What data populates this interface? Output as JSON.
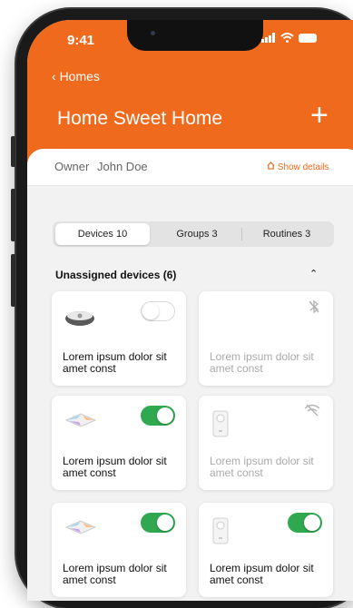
{
  "status_bar": {
    "time": "9:41"
  },
  "nav": {
    "back_label": "Homes",
    "title": "Home Sweet Home",
    "add_label": "+"
  },
  "owner": {
    "label": "Owner",
    "name": "John Doe",
    "show_details": "Show details"
  },
  "tabs": [
    {
      "label": "Devices 10",
      "active": true
    },
    {
      "label": "Groups 3",
      "active": false
    },
    {
      "label": "Routines 3",
      "active": false
    }
  ],
  "section": {
    "title": "Unassigned devices (6)"
  },
  "devices": [
    {
      "label": "Lorem ipsum dolor sit amet const",
      "icon": "light-dome-icon",
      "status": "toggle-off",
      "muted": false
    },
    {
      "label": "Lorem ipsum dolor sit amet const",
      "icon": "none",
      "status": "bluetooth-off",
      "muted": true
    },
    {
      "label": "Lorem ipsum dolor sit amet const",
      "icon": "light-panel-icon",
      "status": "toggle-on",
      "muted": false
    },
    {
      "label": "Lorem ipsum dolor sit amet const",
      "icon": "smart-plug-icon",
      "status": "wifi-off",
      "muted": true
    },
    {
      "label": "Lorem ipsum dolor sit amet const",
      "icon": "light-panel-icon",
      "status": "toggle-on",
      "muted": false
    },
    {
      "label": "Lorem ipsum dolor sit amet const",
      "icon": "smart-plug-icon",
      "status": "toggle-on",
      "muted": false
    }
  ],
  "colors": {
    "brand": "#ef6a1c",
    "toggle_on": "#2fa84f",
    "muted_text": "#aaaaaa"
  }
}
